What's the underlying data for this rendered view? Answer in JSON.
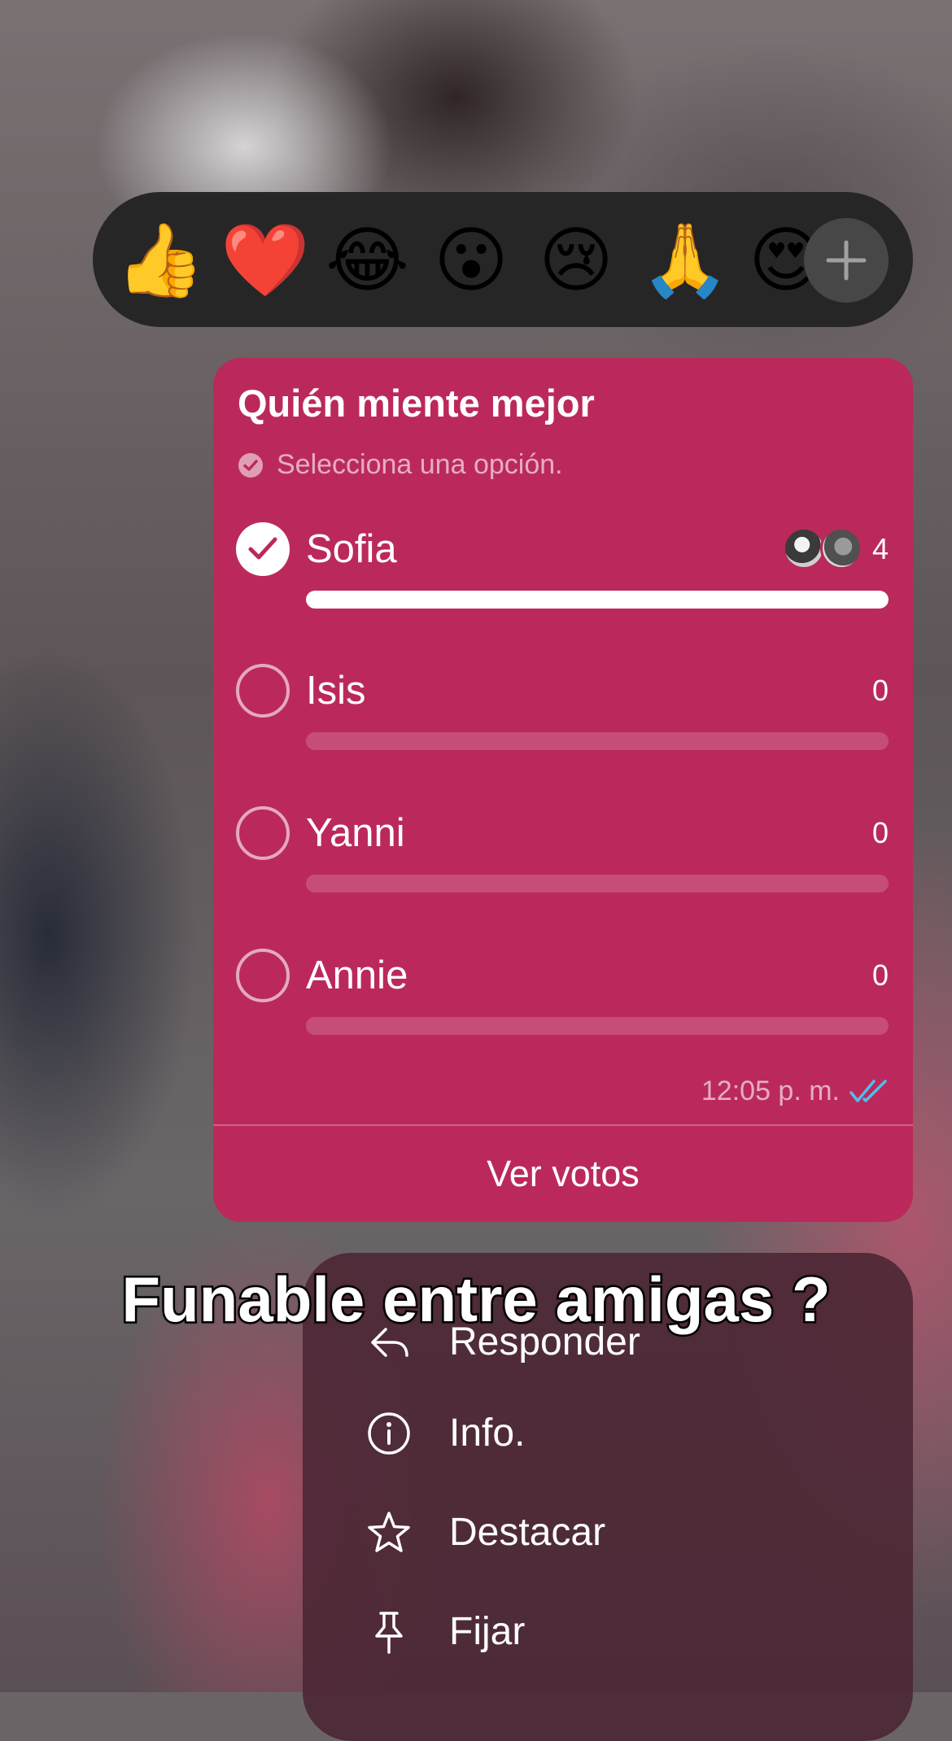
{
  "reactions": {
    "emojis": [
      "👍",
      "❤️",
      "😂",
      "😮",
      "😢",
      "🙏",
      "😍"
    ],
    "add_icon": "plus-icon"
  },
  "poll": {
    "title": "Quién miente mejor",
    "subtitle": "Selecciona una opción.",
    "options": [
      {
        "label": "Sofia",
        "count": "4",
        "selected": true,
        "fraction": 1.0
      },
      {
        "label": "Isis",
        "count": "0",
        "selected": false,
        "fraction": 0
      },
      {
        "label": "Yanni",
        "count": "0",
        "selected": false,
        "fraction": 0
      },
      {
        "label": "Annie",
        "count": "0",
        "selected": false,
        "fraction": 0
      }
    ],
    "timestamp": "12:05 p. m.",
    "view_votes": "Ver votos",
    "colors": {
      "card": "#bb295c",
      "read_ticks": "#53bdeb"
    }
  },
  "menu": {
    "items": [
      {
        "label": "Responder",
        "icon": "reply-icon"
      },
      {
        "label": "Info.",
        "icon": "info-icon"
      },
      {
        "label": "Destacar",
        "icon": "star-icon"
      },
      {
        "label": "Fijar",
        "icon": "pin-icon"
      }
    ]
  },
  "caption": "Funable entre amigas ?"
}
